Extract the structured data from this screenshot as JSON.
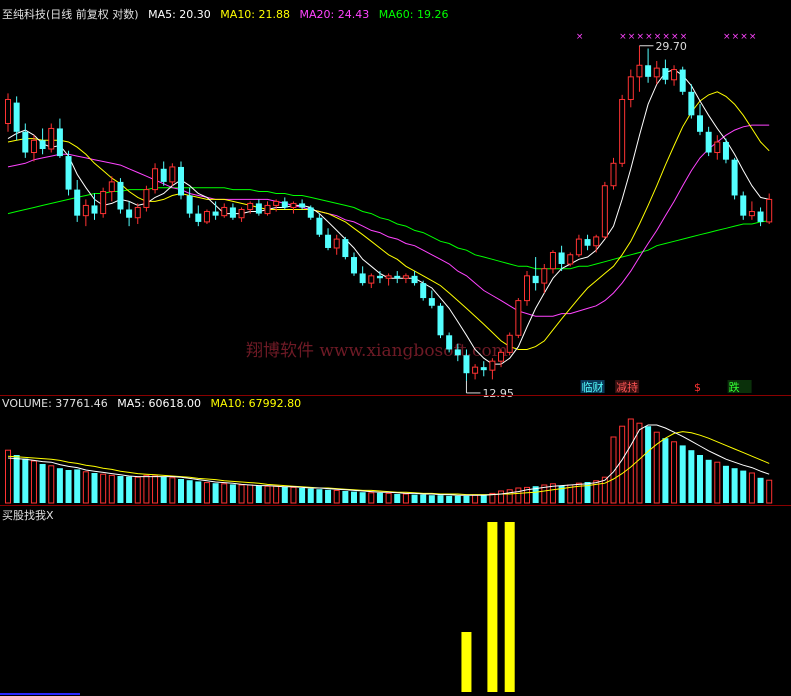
{
  "header": {
    "stock_name": "至纯科技(日线 前复权 对数)",
    "ma5": "MA5: 20.30",
    "ma10": "MA10: 21.88",
    "ma20": "MA20: 24.43",
    "ma60": "MA60: 19.26"
  },
  "volume_header": {
    "volume": "VOLUME: 37761.46",
    "ma5": "MA5: 60618.00",
    "ma10": "MA10: 67992.80"
  },
  "indicator_header": {
    "name": "买股找我X"
  },
  "watermark": "翔博软件 www.xiangbosoft.com",
  "annotations": {
    "high_label": "29.70",
    "low_label": "12.95"
  },
  "tags": {
    "tag1": "临财",
    "tag2": "减持",
    "tag3": "$",
    "tag4": "跌"
  },
  "colors": {
    "up": "#ff3333",
    "down": "#54ffff",
    "ma5": "#ffffff",
    "ma10": "#ffff00",
    "ma20": "#ff44ff",
    "ma60": "#00ff00",
    "indicator": "#ffff00",
    "marker": "#ff44ff"
  },
  "chart_data": [
    {
      "type": "candlestick",
      "scale": "log",
      "ylim": [
        12.6,
        31.5
      ],
      "ohlc": [
        [
          24.5,
          26.4,
          24.0,
          26.0
        ],
        [
          25.8,
          26.2,
          23.5,
          24.0
        ],
        [
          24.0,
          24.5,
          22.5,
          22.8
        ],
        [
          22.8,
          23.8,
          22.3,
          23.5
        ],
        [
          23.5,
          24.2,
          22.7,
          23.0
        ],
        [
          23.0,
          24.5,
          22.8,
          24.2
        ],
        [
          24.2,
          24.8,
          22.5,
          22.6
        ],
        [
          22.6,
          22.9,
          20.5,
          20.8
        ],
        [
          20.8,
          21.3,
          19.2,
          19.5
        ],
        [
          19.5,
          20.3,
          19.0,
          20.0
        ],
        [
          20.0,
          20.6,
          19.3,
          19.6
        ],
        [
          19.6,
          20.9,
          19.4,
          20.7
        ],
        [
          20.7,
          21.5,
          20.2,
          21.2
        ],
        [
          21.2,
          21.4,
          19.6,
          19.8
        ],
        [
          19.8,
          20.2,
          19.0,
          19.4
        ],
        [
          19.4,
          20.1,
          19.1,
          19.9
        ],
        [
          19.9,
          21.0,
          19.7,
          20.8
        ],
        [
          20.8,
          22.2,
          20.6,
          21.9
        ],
        [
          21.9,
          22.3,
          21.0,
          21.2
        ],
        [
          21.2,
          22.2,
          21.0,
          22.0
        ],
        [
          22.0,
          22.3,
          20.3,
          20.5
        ],
        [
          20.5,
          20.9,
          19.4,
          19.6
        ],
        [
          19.6,
          20.0,
          19.0,
          19.2
        ],
        [
          19.2,
          19.8,
          19.1,
          19.7
        ],
        [
          19.7,
          20.2,
          19.3,
          19.5
        ],
        [
          19.5,
          20.1,
          19.4,
          19.9
        ],
        [
          19.9,
          20.1,
          19.3,
          19.4
        ],
        [
          19.4,
          19.9,
          19.2,
          19.8
        ],
        [
          19.8,
          20.2,
          19.6,
          20.1
        ],
        [
          20.1,
          20.3,
          19.5,
          19.6
        ],
        [
          19.6,
          20.2,
          19.5,
          20.0
        ],
        [
          20.0,
          20.3,
          19.7,
          20.2
        ],
        [
          20.2,
          20.4,
          19.8,
          19.9
        ],
        [
          19.9,
          20.2,
          19.6,
          20.1
        ],
        [
          20.1,
          20.3,
          19.8,
          19.9
        ],
        [
          19.9,
          20.0,
          19.3,
          19.4
        ],
        [
          19.4,
          19.6,
          18.5,
          18.6
        ],
        [
          18.6,
          18.9,
          17.9,
          18.0
        ],
        [
          18.0,
          18.6,
          17.7,
          18.4
        ],
        [
          18.4,
          18.5,
          17.5,
          17.6
        ],
        [
          17.6,
          17.8,
          16.8,
          16.9
        ],
        [
          16.9,
          17.2,
          16.4,
          16.5
        ],
        [
          16.5,
          16.9,
          16.3,
          16.8
        ],
        [
          16.8,
          17.0,
          16.5,
          16.7
        ],
        [
          16.7,
          16.9,
          16.4,
          16.8
        ],
        [
          16.8,
          17.0,
          16.5,
          16.7
        ],
        [
          16.7,
          16.9,
          16.5,
          16.8
        ],
        [
          16.8,
          17.0,
          16.4,
          16.5
        ],
        [
          16.5,
          16.6,
          15.8,
          15.9
        ],
        [
          15.9,
          16.2,
          15.5,
          15.6
        ],
        [
          15.6,
          15.7,
          14.4,
          14.5
        ],
        [
          14.5,
          14.6,
          13.9,
          14.0
        ],
        [
          14.0,
          14.2,
          13.6,
          13.8
        ],
        [
          13.8,
          14.0,
          12.95,
          13.2
        ],
        [
          13.2,
          13.5,
          13.0,
          13.4
        ],
        [
          13.4,
          13.6,
          13.1,
          13.3
        ],
        [
          13.3,
          13.7,
          13.0,
          13.6
        ],
        [
          13.6,
          14.0,
          13.4,
          13.9
        ],
        [
          13.9,
          14.6,
          13.8,
          14.5
        ],
        [
          14.5,
          15.9,
          14.4,
          15.8
        ],
        [
          15.8,
          17.0,
          15.6,
          16.8
        ],
        [
          16.8,
          17.6,
          16.2,
          16.5
        ],
        [
          16.5,
          17.3,
          16.1,
          17.1
        ],
        [
          17.1,
          17.9,
          16.9,
          17.8
        ],
        [
          17.8,
          18.1,
          17.0,
          17.3
        ],
        [
          17.3,
          17.8,
          17.2,
          17.7
        ],
        [
          17.7,
          18.6,
          17.6,
          18.4
        ],
        [
          18.4,
          18.6,
          17.9,
          18.1
        ],
        [
          18.1,
          18.6,
          17.8,
          18.5
        ],
        [
          18.5,
          21.2,
          18.4,
          21.0
        ],
        [
          21.0,
          22.5,
          20.8,
          22.2
        ],
        [
          22.2,
          26.3,
          22.0,
          26.0
        ],
        [
          26.0,
          28.0,
          25.5,
          27.5
        ],
        [
          27.5,
          29.7,
          26.5,
          28.3
        ],
        [
          28.3,
          29.5,
          27.1,
          27.5
        ],
        [
          27.5,
          28.6,
          27.0,
          28.1
        ],
        [
          28.1,
          28.7,
          27.0,
          27.3
        ],
        [
          27.3,
          28.3,
          26.9,
          28.0
        ],
        [
          28.0,
          28.2,
          26.3,
          26.5
        ],
        [
          26.5,
          27.0,
          24.8,
          25.0
        ],
        [
          25.0,
          25.7,
          23.8,
          24.0
        ],
        [
          24.0,
          24.3,
          22.6,
          22.8
        ],
        [
          22.8,
          23.8,
          22.4,
          23.4
        ],
        [
          23.4,
          23.6,
          22.2,
          22.4
        ],
        [
          22.4,
          22.5,
          20.3,
          20.5
        ],
        [
          20.5,
          20.7,
          19.3,
          19.5
        ],
        [
          19.5,
          20.2,
          19.3,
          19.7
        ],
        [
          19.7,
          19.9,
          19.0,
          19.2
        ],
        [
          19.2,
          20.6,
          19.1,
          20.3
        ]
      ],
      "ma5": [
        23.6,
        23.9,
        24.1,
        23.8,
        23.3,
        23.1,
        23.2,
        22.6,
        21.6,
        20.9,
        20.3,
        20.0,
        20.1,
        20.3,
        20.2,
        20.0,
        20.1,
        20.4,
        20.6,
        21.0,
        21.3,
        21.0,
        20.6,
        20.4,
        20.0,
        19.6,
        19.6,
        19.6,
        19.7,
        19.7,
        19.8,
        19.9,
        19.9,
        20.0,
        20.0,
        19.9,
        19.6,
        19.2,
        18.8,
        18.4,
        18.0,
        17.5,
        17.2,
        16.9,
        16.7,
        16.7,
        16.7,
        16.7,
        16.5,
        16.3,
        15.9,
        15.5,
        15.0,
        14.5,
        14.0,
        13.7,
        13.5,
        13.5,
        13.7,
        14.1,
        14.8,
        15.5,
        16.1,
        16.7,
        17.1,
        17.3,
        17.5,
        17.6,
        17.9,
        18.4,
        19.0,
        20.3,
        21.9,
        23.8,
        25.7,
        27.0,
        27.8,
        28.0,
        27.6,
        26.9,
        25.9,
        25.0,
        24.2,
        23.5,
        22.7,
        21.8,
        21.0,
        20.4,
        20.3
      ],
      "ma10": [
        23.4,
        23.5,
        23.6,
        23.6,
        23.5,
        23.5,
        23.5,
        23.4,
        23.1,
        22.7,
        22.2,
        21.8,
        21.4,
        21.1,
        20.7,
        20.4,
        20.2,
        20.2,
        20.3,
        20.5,
        20.6,
        20.5,
        20.4,
        20.3,
        20.3,
        20.3,
        20.2,
        20.1,
        20.0,
        19.9,
        19.8,
        19.8,
        19.8,
        19.8,
        19.8,
        19.8,
        19.7,
        19.6,
        19.4,
        19.2,
        18.9,
        18.6,
        18.3,
        18.0,
        17.7,
        17.5,
        17.2,
        17.0,
        16.8,
        16.6,
        16.4,
        16.1,
        15.8,
        15.5,
        15.2,
        14.9,
        14.6,
        14.3,
        14.1,
        14.0,
        14.0,
        14.1,
        14.3,
        14.7,
        15.1,
        15.5,
        15.9,
        16.3,
        16.6,
        16.9,
        17.2,
        17.7,
        18.3,
        19.1,
        20.0,
        21.0,
        22.1,
        23.2,
        24.3,
        25.2,
        25.9,
        26.3,
        26.5,
        26.2,
        25.7,
        25.0,
        24.2,
        23.4,
        22.9
      ],
      "ma20": [
        22.0,
        22.1,
        22.2,
        22.4,
        22.5,
        22.6,
        22.7,
        22.7,
        22.6,
        22.5,
        22.4,
        22.3,
        22.2,
        22.1,
        21.9,
        21.7,
        21.5,
        21.3,
        21.1,
        20.9,
        20.8,
        20.6,
        20.5,
        20.4,
        20.3,
        20.3,
        20.3,
        20.3,
        20.3,
        20.3,
        20.3,
        20.2,
        20.1,
        20.0,
        19.9,
        19.8,
        19.7,
        19.6,
        19.5,
        19.3,
        19.2,
        19.0,
        18.8,
        18.7,
        18.5,
        18.4,
        18.2,
        18.1,
        17.9,
        17.7,
        17.5,
        17.3,
        17.0,
        16.8,
        16.5,
        16.2,
        16.0,
        15.8,
        15.6,
        15.4,
        15.3,
        15.2,
        15.2,
        15.2,
        15.3,
        15.3,
        15.4,
        15.5,
        15.6,
        15.8,
        16.1,
        16.5,
        17.0,
        17.6,
        18.2,
        18.8,
        19.5,
        20.2,
        21.0,
        21.8,
        22.5,
        23.0,
        23.4,
        23.8,
        24.1,
        24.3,
        24.4,
        24.4,
        24.4
      ],
      "ma60": [
        19.6,
        19.7,
        19.8,
        19.9,
        20.0,
        20.1,
        20.2,
        20.3,
        20.4,
        20.5,
        20.6,
        20.6,
        20.7,
        20.7,
        20.8,
        20.8,
        20.8,
        20.9,
        20.9,
        20.9,
        20.9,
        20.9,
        20.9,
        20.9,
        20.9,
        20.9,
        20.8,
        20.8,
        20.8,
        20.7,
        20.7,
        20.6,
        20.6,
        20.5,
        20.5,
        20.4,
        20.3,
        20.2,
        20.1,
        20.0,
        19.9,
        19.7,
        19.6,
        19.4,
        19.3,
        19.1,
        19.0,
        18.8,
        18.7,
        18.5,
        18.3,
        18.2,
        18.0,
        17.9,
        17.7,
        17.6,
        17.5,
        17.4,
        17.3,
        17.2,
        17.2,
        17.1,
        17.1,
        17.1,
        17.1,
        17.1,
        17.2,
        17.2,
        17.3,
        17.4,
        17.5,
        17.6,
        17.7,
        17.8,
        17.9,
        18.1,
        18.2,
        18.3,
        18.4,
        18.5,
        18.6,
        18.7,
        18.8,
        18.9,
        19.0,
        19.1,
        19.1,
        19.2,
        19.26
      ],
      "signal_markers": [
        66,
        71,
        72,
        73,
        74,
        75,
        76,
        77,
        78,
        83,
        84,
        85,
        86
      ]
    },
    {
      "type": "bar",
      "volume": [
        88,
        80,
        74,
        70,
        65,
        62,
        58,
        55,
        56,
        52,
        50,
        48,
        46,
        45,
        44,
        43,
        46,
        45,
        44,
        42,
        40,
        38,
        36,
        34,
        33,
        32,
        31,
        30,
        30,
        29,
        28,
        28,
        27,
        26,
        25,
        24,
        23,
        22,
        21,
        20,
        19,
        18,
        17,
        17,
        16,
        15,
        15,
        14,
        14,
        13,
        13,
        12,
        12,
        12,
        13,
        14,
        16,
        20,
        22,
        25,
        26,
        28,
        30,
        32,
        29,
        30,
        33,
        35,
        37,
        43,
        110,
        128,
        140,
        133,
        128,
        118,
        108,
        102,
        96,
        88,
        80,
        72,
        68,
        62,
        58,
        54,
        50,
        42,
        38
      ],
      "vol_ma5": [
        75,
        74,
        73,
        71,
        69,
        68,
        64,
        61,
        59,
        55,
        53,
        51,
        49,
        47,
        45,
        44,
        44,
        44,
        44,
        44,
        43,
        41,
        39,
        37,
        35,
        34,
        33,
        31,
        30,
        29,
        29,
        28,
        27,
        27,
        26,
        25,
        25,
        24,
        23,
        22,
        21,
        20,
        19,
        18,
        18,
        17,
        16,
        16,
        15,
        15,
        14,
        14,
        13,
        13,
        13,
        13,
        14,
        15,
        17,
        19,
        22,
        24,
        26,
        28,
        29,
        30,
        31,
        32,
        34,
        38,
        52,
        72,
        96,
        122,
        130,
        130,
        125,
        118,
        111,
        103,
        95,
        87,
        80,
        73,
        68,
        63,
        59,
        53,
        48
      ],
      "vol_ma10": [
        78,
        77,
        76,
        75,
        74,
        73,
        71,
        68,
        66,
        63,
        61,
        58,
        56,
        53,
        51,
        49,
        48,
        47,
        46,
        45,
        44,
        43,
        41,
        40,
        39,
        37,
        36,
        35,
        34,
        33,
        31,
        30,
        29,
        28,
        27,
        26,
        25,
        25,
        24,
        23,
        22,
        21,
        21,
        20,
        19,
        18,
        18,
        17,
        16,
        16,
        15,
        15,
        15,
        14,
        14,
        14,
        14,
        15,
        15,
        16,
        17,
        18,
        20,
        22,
        24,
        26,
        28,
        29,
        31,
        33,
        40,
        49,
        60,
        73,
        86,
        98,
        108,
        116,
        119,
        117,
        113,
        108,
        102,
        96,
        90,
        84,
        78,
        72,
        66
      ]
    },
    {
      "type": "bar",
      "bars": [
        {
          "index": 53,
          "value": 30
        },
        {
          "index": 56,
          "value": 85
        },
        {
          "index": 58,
          "value": 85
        }
      ],
      "ylim": [
        0,
        90
      ]
    }
  ]
}
